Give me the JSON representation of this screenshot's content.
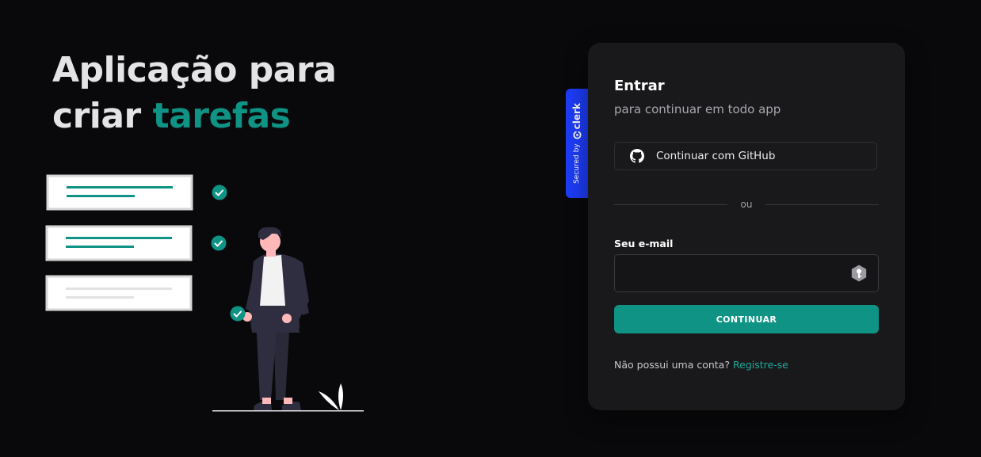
{
  "hero": {
    "title_line1": "Aplicação para",
    "title_line2_prefix": "criar ",
    "title_line2_accent": "tarefas"
  },
  "illustration": {
    "tasks": [
      {
        "status": "done"
      },
      {
        "status": "done"
      },
      {
        "status": "pending"
      }
    ],
    "icons": [
      "check-icon",
      "check-icon",
      "check-icon"
    ]
  },
  "auth": {
    "title": "Entrar",
    "subtitle": "para continuar em todo app",
    "github_button": "Continuar com GitHub",
    "divider": "ou",
    "email_label": "Seu e-mail",
    "email_value": "",
    "continue_button": "CONTINUAR",
    "footer_text": "Não possui uma conta?",
    "footer_link": "Registre-se"
  },
  "badge": {
    "secured_text": "Secured by",
    "brand": "clerk"
  },
  "colors": {
    "background": "#09090b",
    "card": "#19191b",
    "accent": "#0f9384",
    "badge": "#1d3cf6"
  }
}
